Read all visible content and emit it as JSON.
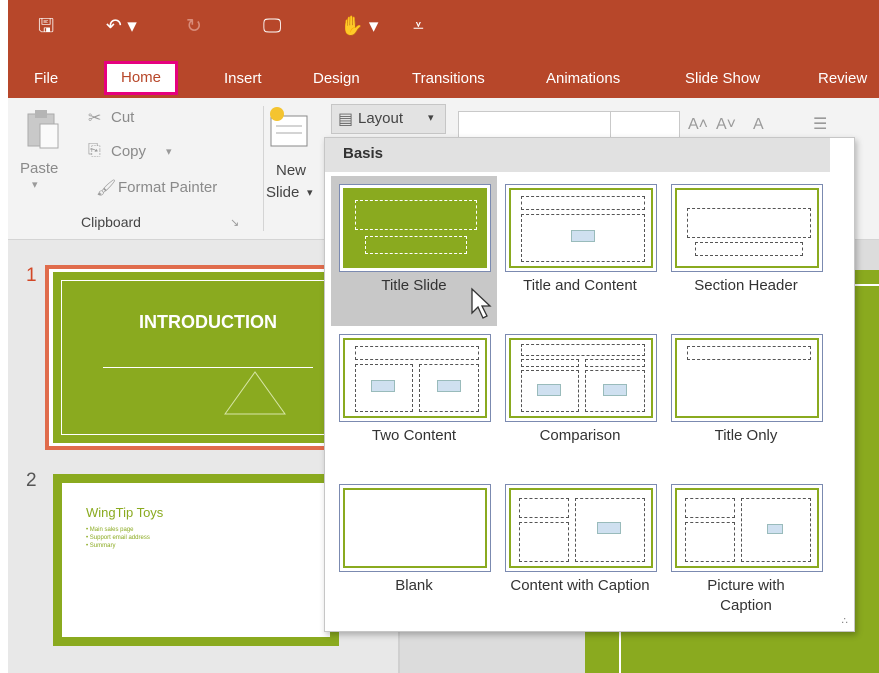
{
  "ribbon_tabs": [
    "File",
    "Home",
    "Insert",
    "Design",
    "Transitions",
    "Animations",
    "Slide Show",
    "Review"
  ],
  "clipboard": {
    "paste": "Paste",
    "cut": "Cut",
    "copy": "Copy",
    "format_painter": "Format Painter",
    "group_label": "Clipboard"
  },
  "slides_group": {
    "new_slide_line1": "New",
    "new_slide_line2": "Slide",
    "layout_button": "Layout"
  },
  "layout_menu": {
    "section": "Basis",
    "items": [
      {
        "label": "Title Slide",
        "selected": true
      },
      {
        "label": "Title and Content"
      },
      {
        "label": "Section Header"
      },
      {
        "label": "Two Content"
      },
      {
        "label": "Comparison"
      },
      {
        "label": "Title Only"
      },
      {
        "label": "Blank"
      },
      {
        "label": "Content with Caption"
      },
      {
        "label": "Picture with Caption"
      }
    ]
  },
  "slides": [
    {
      "number": "1",
      "title": "INTRODUCTION"
    },
    {
      "number": "2",
      "title": "WingTip Toys",
      "bullets": [
        "Main sales page",
        "Support email address",
        "Summary"
      ]
    }
  ],
  "colors": {
    "title_bar": "#b7472a",
    "theme_green": "#8aaa1f",
    "highlight": "#e6007e"
  }
}
